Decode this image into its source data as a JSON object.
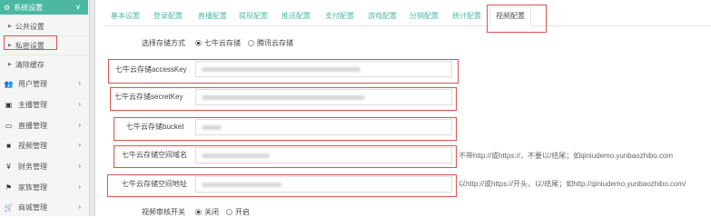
{
  "sidebar": {
    "active_section": "系统设置",
    "sub_items": [
      "公共设置",
      "私密设置",
      "清除缓存"
    ],
    "items": [
      {
        "label": "用户管理",
        "icon": "users-icon"
      },
      {
        "label": "主播管理",
        "icon": "anchor-icon"
      },
      {
        "label": "直播管理",
        "icon": "monitor-icon"
      },
      {
        "label": "视频管理",
        "icon": "video-icon"
      },
      {
        "label": "财务管理",
        "icon": "yen-icon"
      },
      {
        "label": "家族管理",
        "icon": "flag-icon"
      },
      {
        "label": "商城管理",
        "icon": "cart-icon"
      }
    ]
  },
  "tabs": [
    "基本设置",
    "登录配置",
    "直播配置",
    "提现配置",
    "推送配置",
    "支付配置",
    "游戏配置",
    "分销配置",
    "统计配置",
    "视频配置"
  ],
  "form": {
    "storage_label": "选择存储方式",
    "storage_options": [
      "七牛云存储",
      "腾讯云存储"
    ],
    "fields": [
      {
        "label": "七牛云存储accessKey"
      },
      {
        "label": "七牛云存储secretKey"
      },
      {
        "label": "七牛云存储bucket"
      },
      {
        "label": "七牛云存储空间域名",
        "hint": "不带http://或https://，不要以/结尾；如qiniudemo.yunbaozhibo.com"
      },
      {
        "label": "七牛云存储空间地址",
        "hint": "以http://或https://开头，以/结尾；如http://qiniudemo.yunbaozhibo.com/"
      }
    ],
    "video_review_label": "视频审核开关",
    "video_review_options": [
      "关闭",
      "开启"
    ]
  },
  "colors": {
    "accent": "#4cb8a3",
    "highlight_box": "#d9534f"
  }
}
